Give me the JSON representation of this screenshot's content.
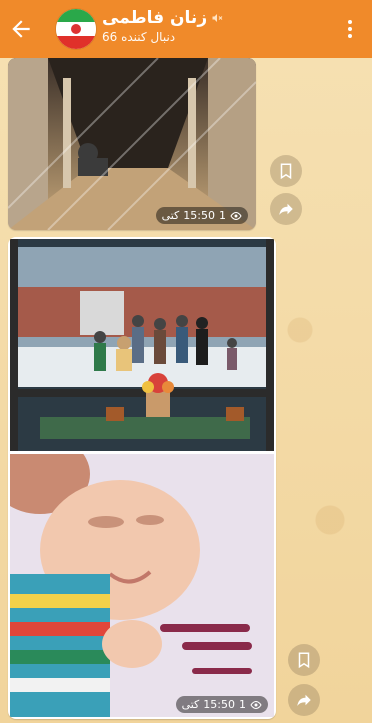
{
  "header": {
    "channel_title": "زنان فاطمی",
    "subscribers": "66 دنبال کننده",
    "back_icon": "arrow-left-icon",
    "menu_icon": "more-vertical-icon",
    "mute_icon": "muted-speaker-icon",
    "background_color": "#f08a2a"
  },
  "messages": [
    {
      "views": "1",
      "time": "15:50",
      "edited": "کتی",
      "image_alt": "corridor with people praying"
    },
    {
      "views": "1",
      "time": "15:50",
      "edited": "کتی",
      "image_alt": "family in snowy courtyard with haft-sin"
    }
  ],
  "side_actions": {
    "bookmark_icon": "bookmark-icon",
    "share_icon": "share-arrow-icon"
  }
}
